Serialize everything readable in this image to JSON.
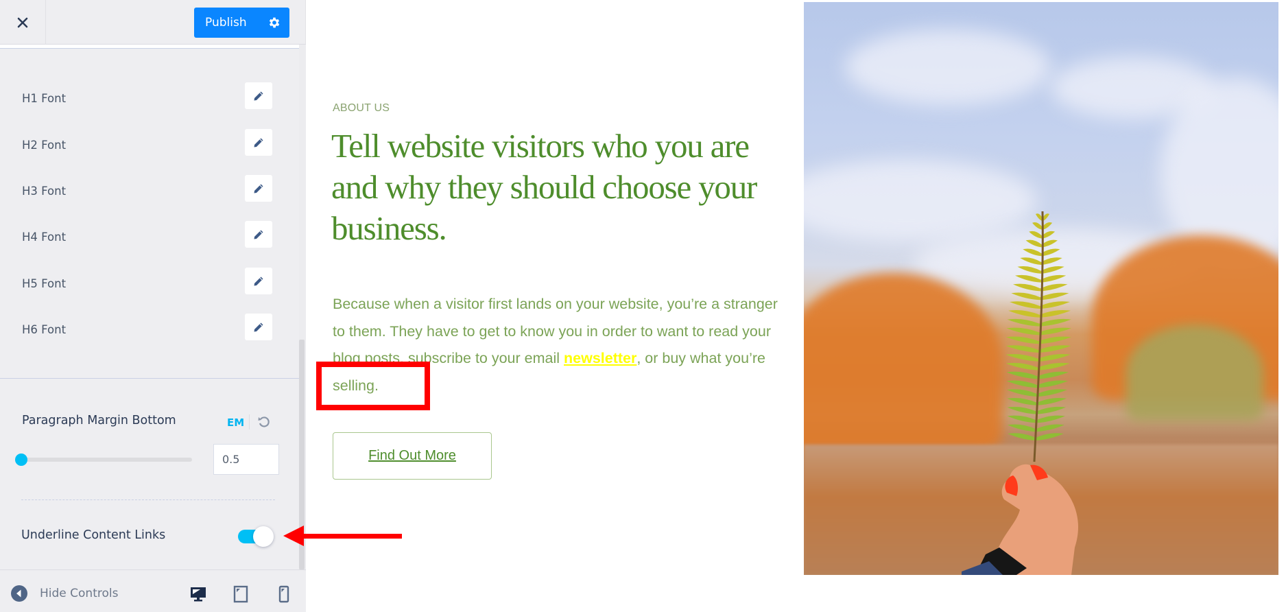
{
  "sidebar": {
    "header": {
      "close_icon": "close-icon",
      "publish_label": "Publish",
      "settings_icon": "gear-icon"
    },
    "font_rows": [
      {
        "label": "H1 Font",
        "icon": "pencil-icon"
      },
      {
        "label": "H2 Font",
        "icon": "pencil-icon"
      },
      {
        "label": "H3 Font",
        "icon": "pencil-icon"
      },
      {
        "label": "H4 Font",
        "icon": "pencil-icon"
      },
      {
        "label": "H5 Font",
        "icon": "pencil-icon"
      },
      {
        "label": "H6 Font",
        "icon": "pencil-icon"
      }
    ],
    "paragraph_margin": {
      "label": "Paragraph Margin Bottom",
      "unit": "EM",
      "reset_icon": "reset-icon",
      "value": "0.5",
      "slider_fraction": 0.0
    },
    "underline_links": {
      "label": "Underline Content Links",
      "enabled": true
    },
    "footer": {
      "hide_controls_label": "Hide Controls",
      "devices": [
        "desktop",
        "tablet",
        "mobile"
      ],
      "active_device": "desktop"
    }
  },
  "preview": {
    "eyebrow": "ABOUT US",
    "headline": "Tell website visitors who you are and why they should choose your business.",
    "paragraph_before_link": "Because when a visitor first lands on your website, you’re a stranger to them. They have to get to know you in order to want to read your blog posts, subscribe to your email ",
    "link_text": "newsletter",
    "paragraph_after_link": ", or buy what you’re selling.",
    "cta_label": "Find Out More",
    "image_description": "Hand holding a green fern leaf in front of autumn trees and a lake"
  },
  "annotations": {
    "highlight_box_color": "#ff0000",
    "arrow_color": "#ff0000"
  },
  "colors": {
    "accent_blue": "#0a86ff",
    "toggle_cyan": "#00bff5",
    "heading_green": "#4e8d2c",
    "link_yellow": "#ffff00"
  }
}
